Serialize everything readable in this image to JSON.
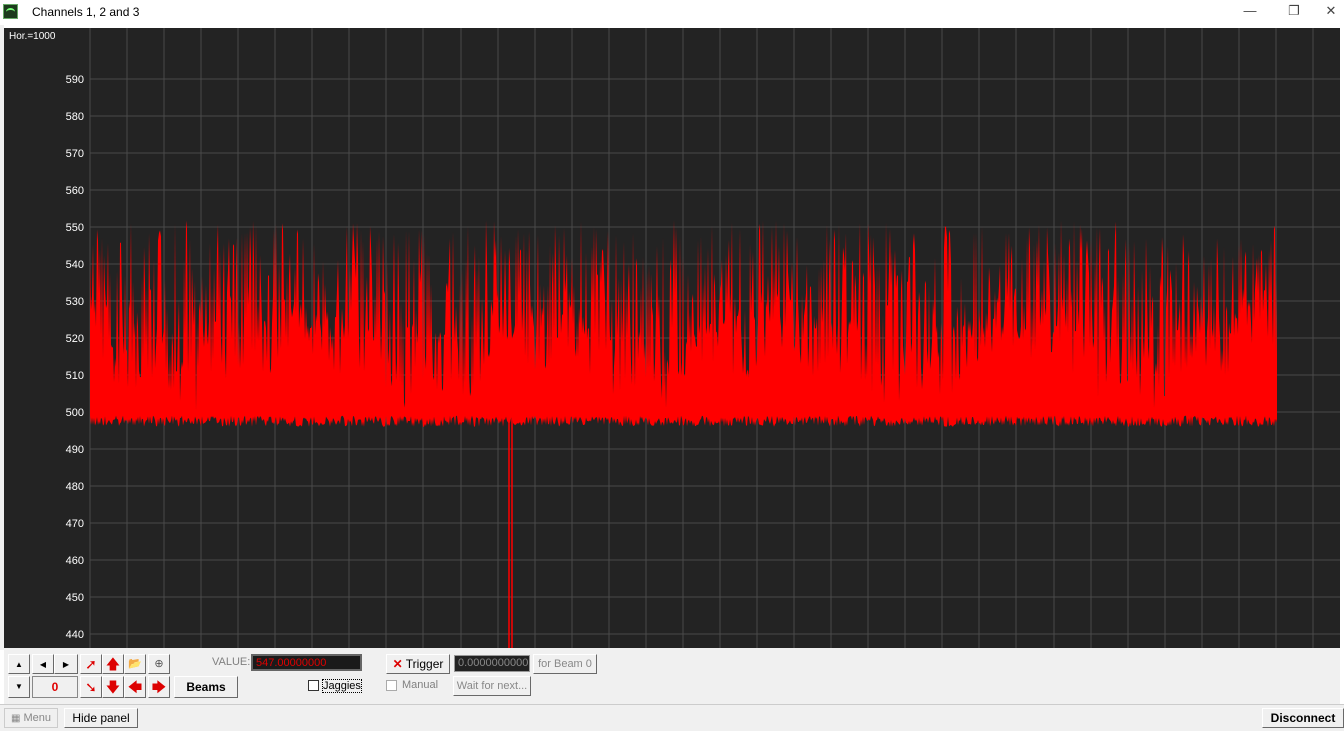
{
  "window": {
    "title": "Channels 1, 2 and 3",
    "minimize": "—",
    "restore": "❐",
    "close": "✕"
  },
  "plot": {
    "hor_label": "Hor.=1000",
    "y_ticks": [
      "590",
      "580",
      "570",
      "560",
      "550",
      "540",
      "530",
      "520",
      "510",
      "500",
      "490",
      "480",
      "470",
      "460",
      "450",
      "440"
    ],
    "trace_color": "#ff0000",
    "background_color": "#232323",
    "grid_color": "#4a4a4a"
  },
  "controls": {
    "value_label": "VALUE:",
    "value": "547.00000000",
    "counter": "0",
    "beams_label": "Beams",
    "jaggies_label": "Jaggies",
    "trigger_label": "Trigger",
    "trigger_value": "0.0000000000",
    "for_beam_label": "for Beam 0",
    "manual_label": "Manual",
    "wait_label": "Wait for next..."
  },
  "statusbar": {
    "menu_label": "Menu",
    "hide_panel_label": "Hide panel",
    "disconnect_label": "Disconnect"
  }
}
